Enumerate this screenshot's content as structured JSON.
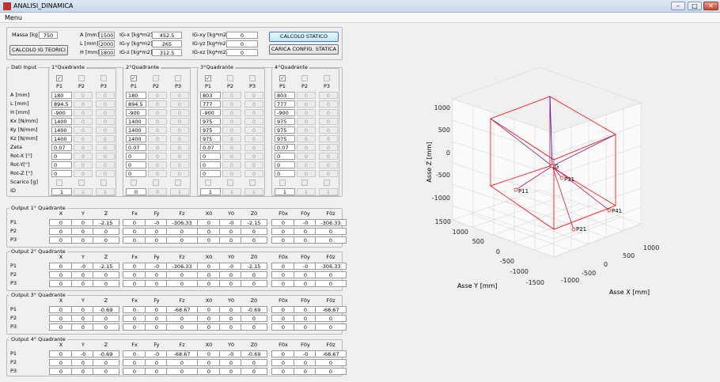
{
  "window": {
    "title": "ANALISI_DINAMICA",
    "minimize": "–",
    "maximize": "□",
    "close": "✕"
  },
  "menu": {
    "label": "Menu"
  },
  "params": {
    "massa_label": "Massa [kg]",
    "massa": "750",
    "dims": [
      {
        "label": "A [mm]",
        "value": "1500"
      },
      {
        "label": "L [mm]",
        "value": "2000"
      },
      {
        "label": "H [mm]",
        "value": "1800"
      }
    ],
    "ig": [
      {
        "label": "IG-x [kg*m2]",
        "value": "452.5"
      },
      {
        "label": "IG-y [kg*m2]",
        "value": "265"
      },
      {
        "label": "IG-z [kg*m2]",
        "value": "312.5"
      }
    ],
    "igx": [
      {
        "label": "IG-xy [kg*m2]",
        "value": "0"
      },
      {
        "label": "IG-yz [kg*m2]",
        "value": "0"
      },
      {
        "label": "IG-xz [kg*m2]",
        "value": "0"
      }
    ],
    "btn_teorici": "CALCOLO IG TEORICI",
    "btn_statico": "CALCOLO STATICO",
    "btn_carica": "CARICA CONFIG. STATICA"
  },
  "dati_input": {
    "title": "Dati Input",
    "row_labels": [
      "A [mm]",
      "L [mm]",
      "H [mm]",
      "Kx [N/mm]",
      "Ky [N/mm]",
      "Kz [N/mm]",
      "Zeta",
      "Rot-X [°]",
      "Rot-Y[°]",
      "Rot-Z [°]",
      "Scarico [g]",
      "ID"
    ],
    "point_labels": [
      "P1",
      "P2",
      "P3"
    ],
    "quadranti": [
      {
        "title": "1°Quadrante",
        "p1": [
          "180",
          "894.5",
          "-900",
          "1400",
          "1400",
          "1400",
          "0.07",
          "0",
          "0",
          "0"
        ],
        "id": [
          "1",
          "1",
          "1"
        ]
      },
      {
        "title": "2°Quadrante",
        "p1": [
          "180",
          "894.5",
          "-900",
          "1400",
          "1400",
          "1400",
          "0.07",
          "0",
          "0",
          "0"
        ],
        "id": [
          "0",
          "0",
          "1"
        ]
      },
      {
        "title": "3°Quadrante",
        "p1": [
          "803",
          "777",
          "-900",
          "975",
          "975",
          "975",
          "0.07",
          "0",
          "0",
          "0"
        ],
        "id": [
          "1",
          "1",
          "1"
        ]
      },
      {
        "title": "4°Quadrante",
        "p1": [
          "803",
          "777",
          "-900",
          "975",
          "975",
          "975",
          "0.07",
          "0",
          "0",
          "0"
        ],
        "id": [
          "1",
          "1",
          "1"
        ]
      }
    ]
  },
  "outputs": {
    "headers": [
      "X",
      "Y",
      "Z",
      "Fx",
      "Fy",
      "Fz",
      "X0",
      "Y0",
      "Z0",
      "F0x",
      "F0y",
      "F0z"
    ],
    "rows": [
      "P1",
      "P2",
      "P3"
    ],
    "groups": [
      {
        "title": "Output 1° Quadrante",
        "p1": [
          "0",
          "0",
          "-2.15",
          "0",
          "-0",
          "-306.33",
          "0",
          "-0",
          "-2.15",
          "0",
          "-0",
          "-306.33"
        ]
      },
      {
        "title": "Output 2° Quadrante",
        "p1": [
          "0",
          "-0",
          "-2.15",
          "0",
          "-0",
          "-306.33",
          "0",
          "-0",
          "-2.15",
          "0",
          "-0",
          "-306.33"
        ]
      },
      {
        "title": "Output 3° Quadrante",
        "p1": [
          "0",
          "0",
          "-0.69",
          "0",
          "0",
          "-68.67",
          "0",
          "0",
          "-0.69",
          "0",
          "0",
          "-68.67"
        ]
      },
      {
        "title": "Output 4° Quadrante",
        "p1": [
          "0",
          "-0",
          "-0.69",
          "0",
          "-0",
          "-68.67",
          "0",
          "-0",
          "-0.69",
          "0",
          "-0",
          "-68.67"
        ]
      }
    ]
  },
  "plot": {
    "zlabel": "Asse Z [mm]",
    "ylabel": "Asse Y [mm]",
    "xlabel": "Asse X [mm]",
    "zticks": [
      "1000",
      "500",
      "0",
      "-500",
      "-1000"
    ],
    "yticks": [
      "1500",
      "1000",
      "500",
      "0",
      "-500",
      "-1000",
      "-1500"
    ],
    "xticks": [
      "-1000",
      "-500",
      "0",
      "500",
      "1000"
    ],
    "points": [
      "G",
      "P11",
      "P21",
      "P31",
      "P41"
    ],
    "box_color": "#ff0000",
    "axis_color": "#0000ff"
  }
}
